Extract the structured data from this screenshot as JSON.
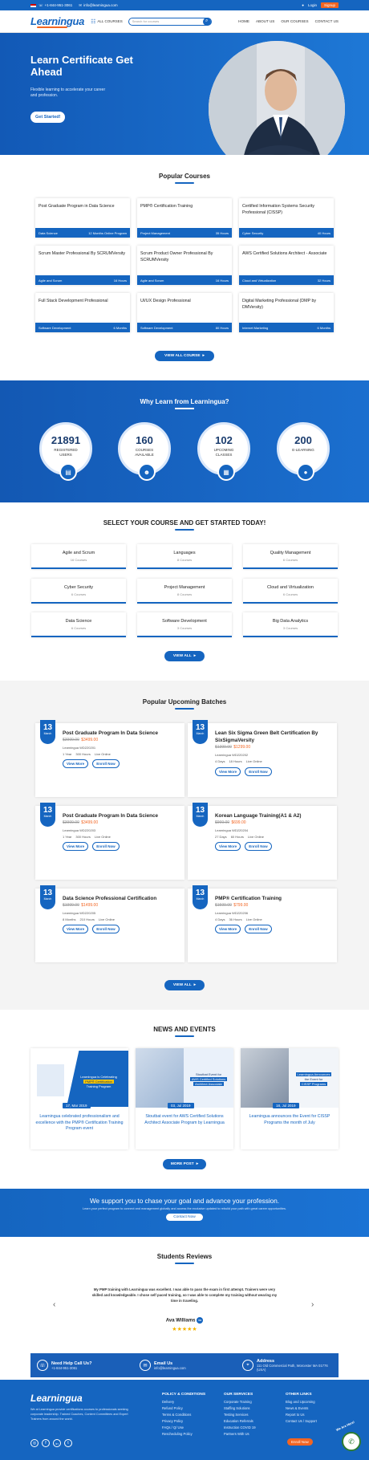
{
  "topbar": {
    "phone": "+1-844-951-3061",
    "email": "info@learningua.com",
    "login": "Login",
    "signup": "Signup"
  },
  "header": {
    "logo": "Learningua",
    "all_courses": "ALL COURSES",
    "search_placeholder": "Search for courses",
    "nav": [
      "HOME",
      "ABOUT US",
      "OUR COURSES",
      "CONTACT US"
    ]
  },
  "hero": {
    "title": "Learn Certificate Get Ahead",
    "subtitle": "Flexible learning to accelerate your career and profession.",
    "cta": "Get Started!"
  },
  "popular": {
    "title": "Popular Courses",
    "courses": [
      {
        "name": "Post Graduate Program in Data Science",
        "cat": "Data Science",
        "dur": "12 Months Online Program"
      },
      {
        "name": "PMP® Certification Training",
        "cat": "Project Management",
        "dur": "35 Hours"
      },
      {
        "name": "Certified Information Systems Security Professional (CISSP)",
        "cat": "Cyber Security",
        "dur": "40 Hours"
      },
      {
        "name": "Scrum Master Professional By SCRUMVersity",
        "cat": "Agile and Scrum",
        "dur": "16 Hours"
      },
      {
        "name": "Scrum Product Owner Professional By SCRUMVersity",
        "cat": "Agile and Scrum",
        "dur": "16 Hours"
      },
      {
        "name": "AWS Certified Solutions Architect - Associate",
        "cat": "Cloud and Virtualization",
        "dur": "32 Hours"
      },
      {
        "name": "Full Stack Development Professional",
        "cat": "Software Development",
        "dur": "6 Months"
      },
      {
        "name": "UI/UX Design Professional",
        "cat": "Software Development",
        "dur": "80 Hours"
      },
      {
        "name": "Digital Marketing Professional (DMP by DMVersity)",
        "cat": "Internet Marketing",
        "dur": "6 Months"
      }
    ],
    "view_all": "VIEW ALL COURSE"
  },
  "why": {
    "title": "Why Learn from Learningua?",
    "stats": [
      {
        "n": "21891",
        "l1": "REGISTERED",
        "l2": "USERS",
        "icon": "certificate-icon"
      },
      {
        "n": "160",
        "l1": "COURSES",
        "l2": "AVAILABLE",
        "icon": "user-icon"
      },
      {
        "n": "102",
        "l1": "UPCOMING",
        "l2": "CLASSES",
        "icon": "calendar-icon"
      },
      {
        "n": "200",
        "l1": "E-LEARNING",
        "l2": "",
        "icon": "play-icon"
      }
    ]
  },
  "select": {
    "title": "SELECT YOUR COURSE AND GET STARTED TODAY!",
    "cats": [
      {
        "n": "Agile and Scrum",
        "c": "16 Courses"
      },
      {
        "n": "Languages",
        "c": "8 Courses"
      },
      {
        "n": "Quality Management",
        "c": "6 Courses"
      },
      {
        "n": "Cyber Security",
        "c": "6 Courses"
      },
      {
        "n": "Project Management",
        "c": "8 Courses"
      },
      {
        "n": "Cloud and Virtualization",
        "c": "6 Courses"
      },
      {
        "n": "Data Science",
        "c": "6 Courses"
      },
      {
        "n": "Software Development",
        "c": "3 Courses"
      },
      {
        "n": "Big Data Analytics",
        "c": "3 Courses"
      }
    ],
    "view_all": "VIEW ALL"
  },
  "batches": {
    "title": "Popular Upcoming Batches",
    "items": [
      {
        "d": "13",
        "m": "March",
        "t": "Post Graduate Program In Data Science",
        "old": "$3999.00",
        "new": "$3499.00",
        "code": "Learningua WD220201",
        "dur": "1 Year",
        "hrs": "300 Hours",
        "mode": "Live Online"
      },
      {
        "d": "13",
        "m": "March",
        "t": "Lean Six Sigma Green Belt Certification By SixSigmaVersity",
        "old": "$1399.00",
        "new": "$1299.00",
        "code": "Learningua WD220202",
        "dur": "4 Days",
        "hrs": "18 Hours",
        "mode": "Live Online"
      },
      {
        "d": "13",
        "m": "March",
        "t": "Post Graduate Program In Data Science",
        "old": "$3999.00",
        "new": "$3499.00",
        "code": "Learningua WD220203",
        "dur": "1 Year",
        "hrs": "300 Hours",
        "mode": "Live Online"
      },
      {
        "d": "13",
        "m": "March",
        "t": "Korean Language Training(A1 & A2)",
        "old": "$999.00",
        "new": "$699.00",
        "code": "Learningua WD220204",
        "dur": "27 Days",
        "hrs": "60 Hours",
        "mode": "Live Online"
      },
      {
        "d": "13",
        "m": "March",
        "t": "Data Science Professional Certification",
        "old": "$1999.00",
        "new": "$1499.00",
        "code": "Learningua WD220205",
        "dur": "8 Months",
        "hrs": "210 Hours",
        "mode": "Live Online"
      },
      {
        "d": "13",
        "m": "March",
        "t": "PMP® Certification Training",
        "old": "$1599.00",
        "new": "$799.00",
        "code": "Learningua WD220206",
        "dur": "4 Days",
        "hrs": "36 Hours",
        "mode": "Live Online"
      }
    ],
    "view_more": "View More",
    "enroll": "Enroll Now",
    "view_all": "VIEW ALL"
  },
  "news": {
    "title": "NEWS AND EVENTS",
    "items": [
      {
        "date": "17, Mar 2019",
        "t": "Learningua celebrated professionalism and excellence with the PMP® Certification Training Program event",
        "img1": "Learningua is Celebrating",
        "img2": "PMP® Certification",
        "img3": "Training Program"
      },
      {
        "date": "03, Jul 2019",
        "t": "Stoutbat event for AWS Certified Solutions Architect Associate Program by Learningua",
        "img1": "Stoutbat Event for",
        "img2": "AWS Certified Solutions",
        "img3": "Architect Associate"
      },
      {
        "date": "18, Jul 2019",
        "t": "Learningua announces the Event for CISSP Programs the month of July",
        "img1": "Learningua Announces",
        "img2": "the Event for",
        "img3": "CISSP Programs"
      }
    ],
    "more": "MORE POST"
  },
  "banner": {
    "title": "We support you to chase your goal and advance your profession.",
    "sub": "Learn your perfect program to connect and management globally and access the exclusive updated to rebuild your path with great career opportunities.",
    "btn": "Contact Now"
  },
  "reviews": {
    "title": "Students Reviews",
    "text": "My PMP training with Learningua was excellent. I was able to pass the exam in first attempt. Trainers were very skilled and knowledgeable. I chose self paced training, so I was able to complete my training without wearing my time in traveling.",
    "name": "Ava Williams",
    "stars": "★★★★★"
  },
  "contact": {
    "help_h": "Need Help Call Us?",
    "help_v": "+1-844-951-3061",
    "email_h": "Email Us",
    "email_v": "info@learningua.com",
    "addr_h": "Address",
    "addr_v": "111 Old Commercial Path, Worcester MA 01776 (USA)"
  },
  "footer": {
    "logo": "Learningua",
    "about": "We at Learningua provide certifications courses to professionals seeking corporate leadership. Trained Coaches, Content Committees and Expert Trainers from around the world.",
    "cols": [
      {
        "h": "POLICY & CONDITIONS",
        "items": [
          "Delivery",
          "Refund Policy",
          "Terms & Conditions",
          "Privacy Policy",
          "FAQs / Q/ Use",
          "Rescheduling Policy"
        ]
      },
      {
        "h": "OUR SERVICES",
        "items": [
          "Corporate Training",
          "Staffing Solutions",
          "Testing Services",
          "Education Referrals",
          "Instruction COVID 19",
          "Partners With Us"
        ]
      },
      {
        "h": "OTHER LINKS",
        "items": [
          "Blog and Upcoming",
          "News & Events",
          "Report to Us",
          "Contact Us / Support"
        ]
      }
    ],
    "chat": "We Are Here!",
    "cta": "Enroll Now"
  }
}
